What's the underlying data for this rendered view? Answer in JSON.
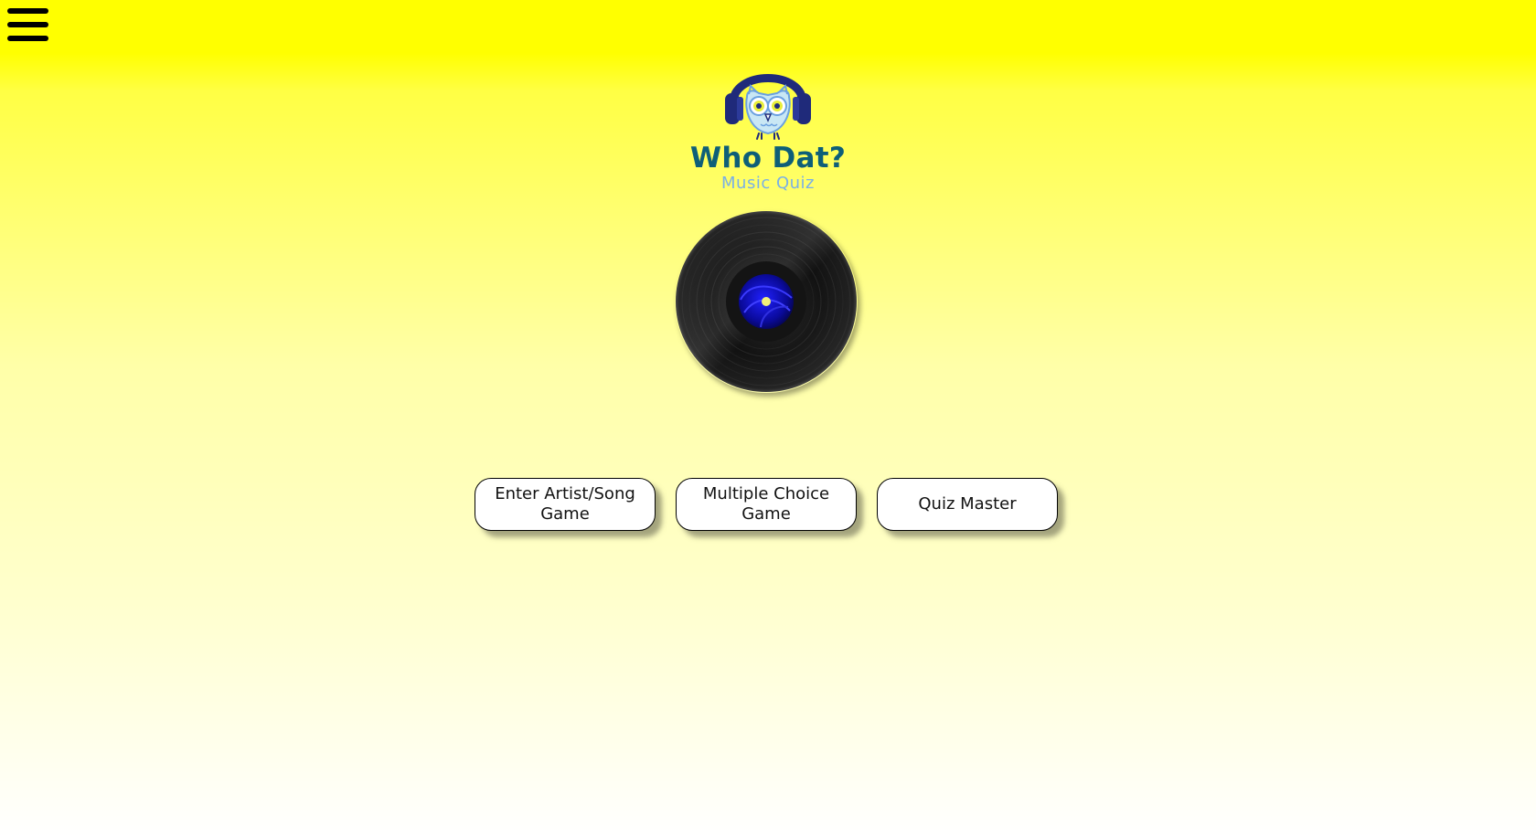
{
  "header": {
    "menu_icon": "hamburger-menu-icon",
    "background_color": "#ffff00"
  },
  "logo": {
    "icon": "owl-headphones-icon",
    "title": "Who Dat?",
    "subtitle": "Music Quiz",
    "title_color": "#0e5f78",
    "subtitle_color": "#7ab0e6"
  },
  "record": {
    "icon": "vinyl-record-icon",
    "label_color": "#1010c8"
  },
  "games": [
    {
      "label": "Enter Artist/Song Game"
    },
    {
      "label": "Multiple Choice Game"
    },
    {
      "label": "Quiz Master"
    }
  ]
}
